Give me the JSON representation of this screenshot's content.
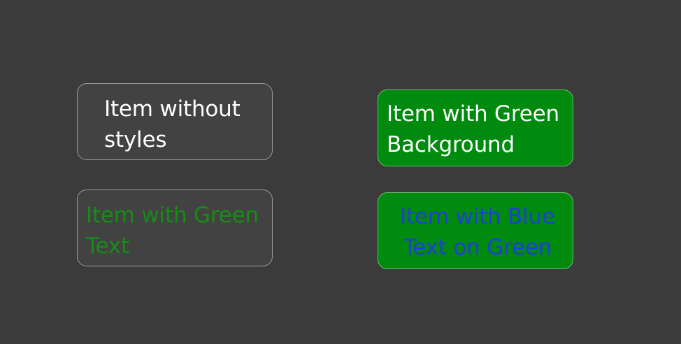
{
  "items": [
    {
      "label": "Item without\nstyles"
    },
    {
      "label": "Item with Green\nText"
    },
    {
      "label": "Item with Green\nBackground"
    },
    {
      "label": "Item with Blue\nText on Green"
    }
  ],
  "colors": {
    "window_background": "#3b3b3b",
    "item_background": "#424242",
    "item_border": "#9a9a9a",
    "green_background": "#008a0e",
    "green_text": "#158d15",
    "blue_text": "#1f3fdc",
    "white_text": "#ffffff"
  }
}
